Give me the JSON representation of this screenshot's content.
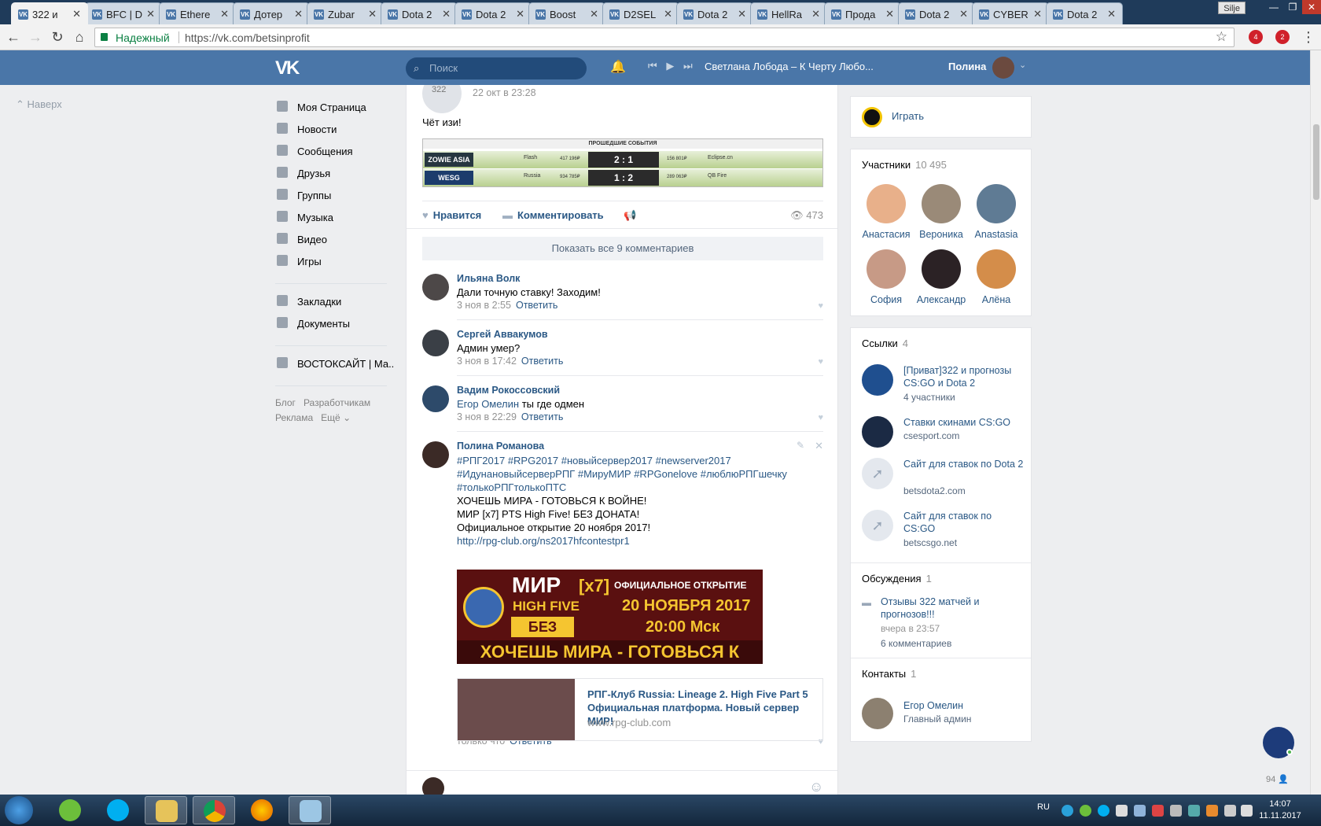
{
  "browser": {
    "tabs": [
      "322 и",
      "BFC | D",
      "Ethere",
      "Дотер",
      "Zubar",
      "Dota 2",
      "Dota 2",
      "Boost",
      "D2SEL",
      "Dota 2",
      "HellRa",
      "Прода",
      "Dota 2",
      "CYBER",
      "Dota 2"
    ],
    "user_badge": "Silje",
    "secure_label": "Надежный",
    "url": "https://vk.com/betsinprofit",
    "ext_counts": [
      "4",
      "2"
    ]
  },
  "vk": {
    "logo": "VK",
    "search_placeholder": "Поиск",
    "now_playing": "Светлана Лобода – К Черту Любо...",
    "user_name": "Полина"
  },
  "back_to_top": "Наверх",
  "menu": {
    "items": [
      "Моя Страница",
      "Новости",
      "Сообщения",
      "Друзья",
      "Группы",
      "Музыка",
      "Видео",
      "Игры"
    ],
    "items2": [
      "Закладки",
      "Документы"
    ],
    "community": "ВОСТОКСАЙТ | Ма..",
    "footer": [
      "Блог",
      "Разработчикам",
      "Реклама",
      "Ещё"
    ]
  },
  "post": {
    "author_short": "322",
    "date": "22 окт в 23:28",
    "text": "Чёт изи!",
    "banner": {
      "title": "ПРОШЕДШИЕ СОБЫТИЯ",
      "rows": [
        {
          "league": "ZOWIE ASIA",
          "team1": "Flash",
          "odds1": "417 196₽",
          "score": "2 : 1",
          "odds2": "156 801₽",
          "team2": "Eclipse.cn"
        },
        {
          "league": "WESG",
          "team1": "Russia",
          "odds1": "934 785₽",
          "score": "1 : 2",
          "odds2": "289 063₽",
          "team2": "QB Fire"
        }
      ]
    },
    "like": "Нравится",
    "comment": "Комментировать",
    "views": "473",
    "show_all": "Показать все 9 комментариев"
  },
  "comments": [
    {
      "name": "Ильяна Волк",
      "text": "Дали точную ставку! Заходим!",
      "date": "3 ноя в 2:55",
      "reply": "Ответить"
    },
    {
      "name": "Сергей Аввакумов",
      "text": "Админ умер?",
      "date": "3 ноя в 17:42",
      "reply": "Ответить"
    },
    {
      "name": "Вадим Рокоссовский",
      "mention": "Егор Омелин",
      "text": " ты где одмен",
      "date": "3 ноя в 22:29",
      "reply": "Ответить"
    },
    {
      "name": "Полина Романова",
      "tags1": "#РПГ2017 #RPG2017 #новыйсервер2017 #newserver2017",
      "tags2": "#ИдунановыйсерверРПГ #МируМИР #RPGonelove #люблюРПГшечку",
      "tags3": "#толькоРПГтолькоПТС",
      "l1": "ХОЧЕШЬ МИРА - ГОТОВЬСЯ К ВОЙНЕ!",
      "l2": "МИР [x7] PTS High Five! БЕЗ ДОНАТА!",
      "l3": "Официальное открытие 20 ноября 2017!",
      "link": "http://rpg-club.org/ns2017hfcontestpr1",
      "date": "только что",
      "reply": "Ответить"
    }
  ],
  "ad_image": {
    "mir": "МИР",
    "x7": "[x7]",
    "official": "ОФИЦИАЛЬНОЕ ОТКРЫТИЕ",
    "hf": "HIGH FIVE",
    "date": "20 НОЯБРЯ 2017",
    "nodon": "БЕЗ ДОНАТА",
    "time": "20:00 Мск",
    "slogan": "ХОЧЕШЬ МИРА - ГОТОВЬСЯ К ВОЙНЕ"
  },
  "link_card": {
    "title": "РПГ-Клуб Russia: Lineage 2. High Five Part 5 Официальная платформа. Новый сервер МИР!",
    "url": "www.rpg-club.com"
  },
  "right": {
    "play": "Играть",
    "members_label": "Участники",
    "members_count": "10 495",
    "members": [
      "Анастасия",
      "Вероника",
      "Anastasia",
      "София",
      "Александр",
      "Алёна"
    ],
    "links_label": "Ссылки",
    "links_count": "4",
    "links": [
      {
        "title": "[Приват]322 и прогнозы CS:GO и Dota 2",
        "sub": "4 участники"
      },
      {
        "title": "Ставки скинами CS:GO",
        "sub": "csesport.com"
      },
      {
        "title": "Сайт для ставок по Dota 2",
        "sub": "betsdota2.com"
      },
      {
        "title": "Сайт для ставок по CS:GO",
        "sub": "betscsgo.net"
      }
    ],
    "disc_label": "Обсуждения",
    "disc_count": "1",
    "disc_title": "Отзывы 322 матчей и прогнозов!!!",
    "disc_date": "вчера в 23:57",
    "disc_comments": "6 комментариев",
    "contacts_label": "Контакты",
    "contacts_count": "1",
    "contact_name": "Егор Омелин",
    "contact_role": "Главный админ"
  },
  "chat_count": "94",
  "taskbar": {
    "lang": "RU",
    "time": "14:07",
    "date": "11.11.2017"
  }
}
